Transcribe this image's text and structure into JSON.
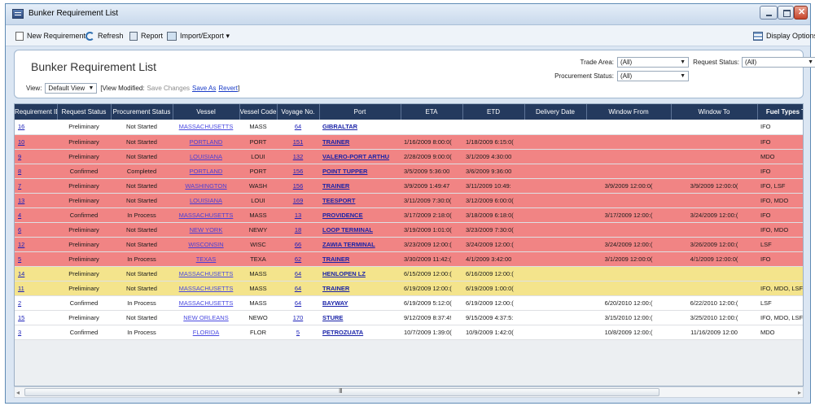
{
  "window": {
    "title": "Bunker Requirement List"
  },
  "toolbar": {
    "new_requirement": "New Requirement",
    "refresh": "Refresh",
    "report": "Report",
    "import_export": "Import/Export ▾",
    "display_options": "Display Options ▾"
  },
  "panel": {
    "title": "Bunker Requirement List",
    "view_label": "View:",
    "view_value": "Default View",
    "view_modified": "[View Modified:",
    "save_changes": "Save Changes",
    "save_as": "Save As",
    "revert": "Revert",
    "close_bracket": "]",
    "trade_area_label": "Trade Area:",
    "trade_area_value": "(All)",
    "request_status_label": "Request Status:",
    "request_status_value": "(All)",
    "procurement_status_label": "Procurement Status:",
    "procurement_status_value": "(All)"
  },
  "table": {
    "columns": [
      "Requirement ID",
      "Request Status",
      "Procurement Status",
      "Vessel",
      "Vessel Code",
      "Voyage No.",
      "Port",
      "ETA",
      "ETD",
      "Delivery Date",
      "Window From",
      "Window To",
      "Fuel Types T"
    ],
    "rows": [
      {
        "id": "16",
        "req": "Preliminary",
        "proc": "Not Started",
        "vessel": "MASSACHUSETTS",
        "code": "MASS",
        "voy": "64",
        "port": "GIBRALTAR",
        "eta": "",
        "etd": "",
        "delivery": "",
        "from": "",
        "to": "",
        "fuel": "IFO"
      },
      {
        "id": "10",
        "req": "Preliminary",
        "proc": "Not Started",
        "vessel": "PORTLAND",
        "code": "PORT",
        "voy": "151",
        "port": "TRAINER",
        "eta": "1/16/2009 8:00:0(",
        "etd": "1/18/2009 6:15:0(",
        "delivery": "",
        "from": "",
        "to": "",
        "fuel": "IFO"
      },
      {
        "id": "9",
        "req": "Preliminary",
        "proc": "Not Started",
        "vessel": "LOUISIANA",
        "code": "LOUI",
        "voy": "132",
        "port": "VALERO-PORT ARTHU",
        "eta": "2/28/2009 9:00:0(",
        "etd": "3/1/2009 4:30:00",
        "delivery": "",
        "from": "",
        "to": "",
        "fuel": "MDO"
      },
      {
        "id": "8",
        "req": "Confirmed",
        "proc": "Completed",
        "vessel": "PORTLAND",
        "code": "PORT",
        "voy": "156",
        "port": "POINT TUPPER",
        "eta": "3/5/2009 5:36:00",
        "etd": "3/6/2009 9:36:00",
        "delivery": "",
        "from": "",
        "to": "",
        "fuel": "IFO"
      },
      {
        "id": "7",
        "req": "Preliminary",
        "proc": "Not Started",
        "vessel": "WASHINGTON",
        "code": "WASH",
        "voy": "156",
        "port": "TRAINER",
        "eta": "3/9/2009 1:49:47",
        "etd": "3/11/2009 10:49:",
        "delivery": "",
        "from": "3/9/2009 12:00:0(",
        "to": "3/9/2009 12:00:0(",
        "fuel": "IFO, LSF"
      },
      {
        "id": "13",
        "req": "Preliminary",
        "proc": "Not Started",
        "vessel": "LOUISIANA",
        "code": "LOUI",
        "voy": "169",
        "port": "TEESPORT",
        "eta": "3/11/2009 7:30:0(",
        "etd": "3/12/2009 6:00:0(",
        "delivery": "",
        "from": "",
        "to": "",
        "fuel": "IFO, MDO"
      },
      {
        "id": "4",
        "req": "Confirmed",
        "proc": "In Process",
        "vessel": "MASSACHUSETTS",
        "code": "MASS",
        "voy": "13",
        "port": "PROVIDENCE",
        "eta": "3/17/2009 2:18:0(",
        "etd": "3/18/2009 6:18:0(",
        "delivery": "",
        "from": "3/17/2009 12:00:(",
        "to": "3/24/2009 12:00:(",
        "fuel": "IFO"
      },
      {
        "id": "6",
        "req": "Preliminary",
        "proc": "Not Started",
        "vessel": "NEW YORK",
        "code": "NEWY",
        "voy": "18",
        "port": "LOOP TERMINAL",
        "eta": "3/19/2009 1:01:0(",
        "etd": "3/23/2009 7:30:0(",
        "delivery": "",
        "from": "",
        "to": "",
        "fuel": "IFO, MDO"
      },
      {
        "id": "12",
        "req": "Preliminary",
        "proc": "Not Started",
        "vessel": "WISCONSIN",
        "code": "WISC",
        "voy": "66",
        "port": "ZAWIA TERMINAL",
        "eta": "3/23/2009 12:00:(",
        "etd": "3/24/2009 12:00:(",
        "delivery": "",
        "from": "3/24/2009 12:00:(",
        "to": "3/26/2009 12:00:(",
        "fuel": "LSF"
      },
      {
        "id": "5",
        "req": "Preliminary",
        "proc": "In Process",
        "vessel": "TEXAS",
        "code": "TEXA",
        "voy": "62",
        "port": "TRAINER",
        "eta": "3/30/2009 11:42:(",
        "etd": "4/1/2009 3:42:00",
        "delivery": "",
        "from": "3/1/2009 12:00:0(",
        "to": "4/1/2009 12:00:0(",
        "fuel": "IFO"
      },
      {
        "id": "14",
        "req": "Preliminary",
        "proc": "Not Started",
        "vessel": "MASSACHUSETTS",
        "code": "MASS",
        "voy": "64",
        "port": "HENLOPEN LZ",
        "eta": "6/15/2009 12:00:(",
        "etd": "6/16/2009 12:00:(",
        "delivery": "",
        "from": "",
        "to": "",
        "fuel": ""
      },
      {
        "id": "11",
        "req": "Preliminary",
        "proc": "Not Started",
        "vessel": "MASSACHUSETTS",
        "code": "MASS",
        "voy": "64",
        "port": "TRAINER",
        "eta": "6/19/2009 12:00:(",
        "etd": "6/19/2009 1:00:0(",
        "delivery": "",
        "from": "",
        "to": "",
        "fuel": "IFO, MDO, LSF"
      },
      {
        "id": "2",
        "req": "Confirmed",
        "proc": "In Process",
        "vessel": "MASSACHUSETTS",
        "code": "MASS",
        "voy": "64",
        "port": "BAYWAY",
        "eta": "6/19/2009 5:12:0(",
        "etd": "6/19/2009 12:00:(",
        "delivery": "",
        "from": "6/20/2010 12:00:(",
        "to": "6/22/2010 12:00:(",
        "fuel": "LSF"
      },
      {
        "id": "15",
        "req": "Preliminary",
        "proc": "Not Started",
        "vessel": "NEW ORLEANS",
        "code": "NEWO",
        "voy": "170",
        "port": "STURE",
        "eta": "9/12/2009 8:37:4!",
        "etd": "9/15/2009 4:37:5:",
        "delivery": "",
        "from": "3/15/2010 12:00:(",
        "to": "3/25/2010 12:00:(",
        "fuel": "IFO, MDO, LSF"
      },
      {
        "id": "3",
        "req": "Confirmed",
        "proc": "In Process",
        "vessel": "FLORIDA",
        "code": "FLOR",
        "voy": "5",
        "port": "PETROZUATA",
        "eta": "10/7/2009 1:39:0(",
        "etd": "10/9/2009 1:42:0(",
        "delivery": "",
        "from": "10/8/2009 12:00:(",
        "to": "11/16/2009 12:00",
        "fuel": "MDO"
      }
    ],
    "row_colors": [
      "white",
      "red",
      "red",
      "red",
      "red",
      "red",
      "red",
      "red",
      "red",
      "red",
      "yellow",
      "yellow",
      "white",
      "white",
      "white"
    ]
  },
  "scrollbar": {
    "left_arrow": "◂",
    "right_arrow": "▸",
    "grip": "III"
  }
}
